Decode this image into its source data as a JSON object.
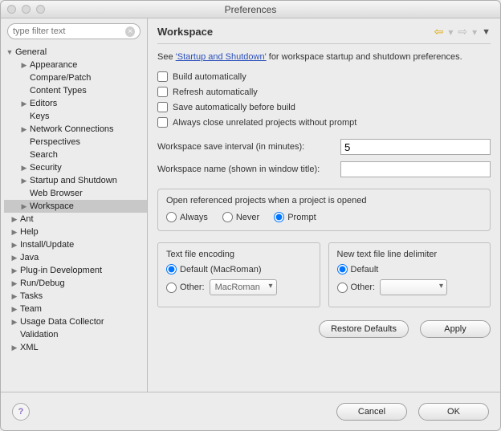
{
  "window": {
    "title": "Preferences"
  },
  "search": {
    "placeholder": "type filter text"
  },
  "tree": {
    "general": "General",
    "appearance": "Appearance",
    "compare": "Compare/Patch",
    "contentTypes": "Content Types",
    "editors": "Editors",
    "keys": "Keys",
    "network": "Network Connections",
    "perspectives": "Perspectives",
    "searchItem": "Search",
    "security": "Security",
    "startup": "Startup and Shutdown",
    "webBrowser": "Web Browser",
    "workspace": "Workspace",
    "ant": "Ant",
    "help": "Help",
    "install": "Install/Update",
    "java": "Java",
    "plugin": "Plug-in Development",
    "rundebug": "Run/Debug",
    "tasks": "Tasks",
    "team": "Team",
    "usage": "Usage Data Collector",
    "validation": "Validation",
    "xml": "XML"
  },
  "page": {
    "title": "Workspace",
    "descPrefix": "See ",
    "descLink": "'Startup and Shutdown'",
    "descSuffix": " for workspace startup and shutdown preferences.",
    "buildAuto": "Build automatically",
    "refreshAuto": "Refresh automatically",
    "saveAuto": "Save automatically before build",
    "closeUnrelated": "Always close unrelated projects without prompt",
    "saveIntervalLabel": "Workspace save interval (in minutes):",
    "saveIntervalValue": "5",
    "wsNameLabel": "Workspace name (shown in window title):",
    "wsNameValue": "",
    "openRef": {
      "label": "Open referenced projects when a project is opened",
      "always": "Always",
      "never": "Never",
      "prompt": "Prompt"
    },
    "encoding": {
      "label": "Text file encoding",
      "default": "Default (MacRoman)",
      "other": "Other:",
      "otherValue": "MacRoman"
    },
    "delimiter": {
      "label": "New text file line delimiter",
      "default": "Default",
      "other": "Other:"
    },
    "restoreDefaults": "Restore Defaults",
    "apply": "Apply",
    "cancel": "Cancel",
    "ok": "OK"
  }
}
